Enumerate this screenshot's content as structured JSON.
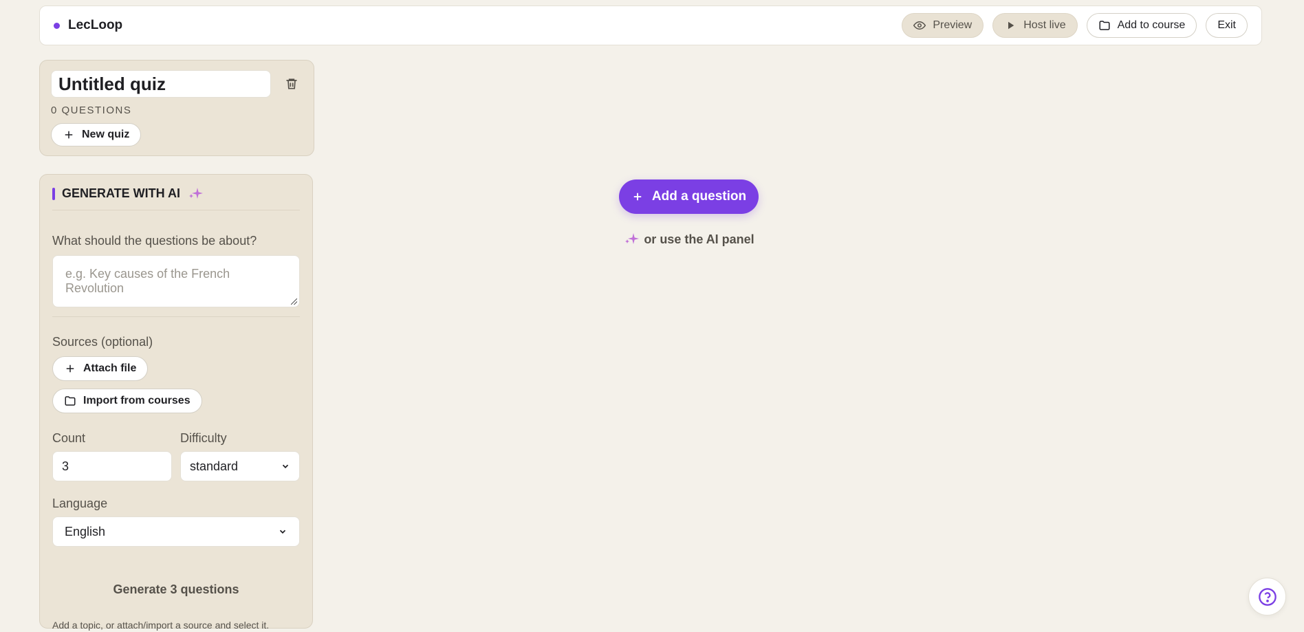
{
  "header": {
    "brand": "LecLoop",
    "preview_label": "Preview",
    "host_live_label": "Host live",
    "add_to_course_label": "Add to course",
    "exit_label": "Exit"
  },
  "quiz": {
    "title": "Untitled quiz",
    "question_count": "0 QUESTIONS",
    "new_quiz_label": "New quiz"
  },
  "ai_panel": {
    "title": "GENERATE WITH AI",
    "topic_label": "What should the questions be about?",
    "topic_placeholder": "e.g. Key causes of the French Revolution",
    "sources_label": "Sources (optional)",
    "attach_file_label": "Attach file",
    "import_label": "Import from courses",
    "count_label": "Count",
    "count_value": "3",
    "difficulty_label": "Difficulty",
    "difficulty_value": "standard",
    "language_label": "Language",
    "language_value": "English",
    "generate_label": "Generate 3 questions",
    "hint": "Add a topic, or attach/import a source and select it."
  },
  "main": {
    "add_question_label": "Add a question",
    "ai_alt_label": "or use the AI panel"
  },
  "colors": {
    "accent": "#7b3fe4",
    "sparkle": "#c070d8",
    "background": "#f4f1ea",
    "panel": "#ebe4d6"
  },
  "icons": [
    "eye-icon",
    "play-icon",
    "folder-icon",
    "trash-icon",
    "plus-icon",
    "sparkle-icon",
    "chevron-down-icon",
    "help-icon"
  ]
}
